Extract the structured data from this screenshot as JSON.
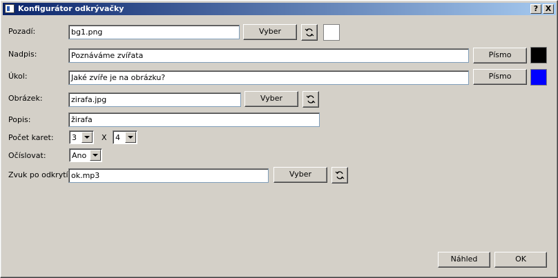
{
  "window": {
    "title": "Konfigurátor odkrývačky",
    "help_button": "?",
    "close_button": "X"
  },
  "fields": {
    "background": {
      "label": "Pozadí:",
      "value": "bg1.png",
      "browse_label": "Vyber",
      "color": "#ffffff"
    },
    "heading": {
      "label": "Nadpis:",
      "value": "Poznáváme zvířata",
      "font_label": "Písmo",
      "color": "#000000"
    },
    "task": {
      "label": "Úkol:",
      "value": "Jaké zvíře je na obrázku?",
      "font_label": "Písmo",
      "color": "#0000ff"
    },
    "image": {
      "label": "Obrázek:",
      "value": "zirafa.jpg",
      "browse_label": "Vyber"
    },
    "description": {
      "label": "Popis:",
      "value": "žirafa"
    },
    "card_count": {
      "label": "Počet karet:",
      "rows": "3",
      "separator": "X",
      "cols": "4"
    },
    "numbering": {
      "label": "Očíslovat:",
      "value": "Ano"
    },
    "sound": {
      "label": "Zvuk po odkrytí:",
      "value": "ok.mp3",
      "browse_label": "Vyber"
    }
  },
  "footer": {
    "preview_label": "Náhled",
    "ok_label": "OK"
  },
  "icons": {
    "refresh": "refresh-icon",
    "app": "app-icon"
  }
}
